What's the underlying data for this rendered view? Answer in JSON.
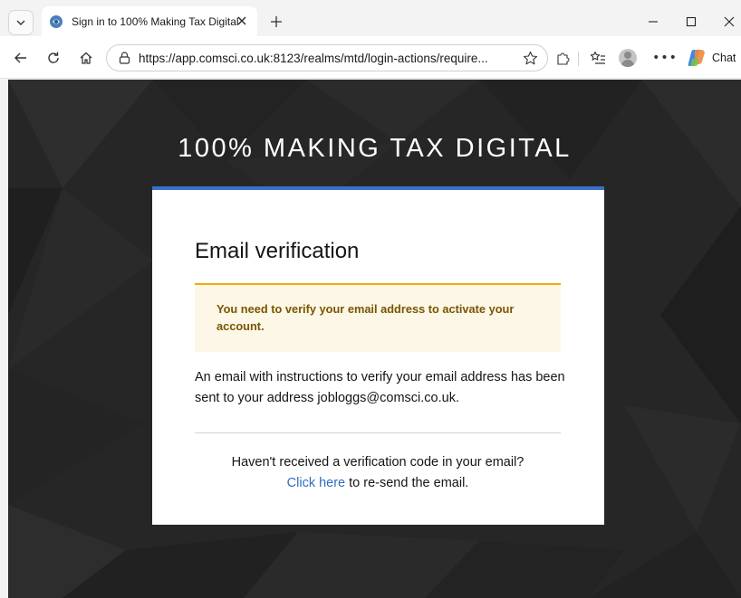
{
  "browser": {
    "tab": {
      "title": "Sign in to 100% Making Tax Digital"
    },
    "address_bar": {
      "url": "https://app.comsci.co.uk:8123/realms/mtd/login-actions/require..."
    },
    "copilot_label": "Chat"
  },
  "page": {
    "site_title": "100% MAKING TAX DIGITAL",
    "card": {
      "heading": "Email verification",
      "alert_text": "You need to verify your email address to activate your account.",
      "info_text": "An email with instructions to verify your email address has been sent to your address jobloggs@comsci.co.uk.",
      "resend_prompt": "Haven't received a verification code in your email?",
      "resend_link": "Click here",
      "resend_suffix": " to re-send the email."
    }
  },
  "colors": {
    "accent_bar": "#3b6fc9",
    "alert_border": "#f0ab00",
    "alert_background": "#fdf7e7",
    "link": "#2f6ec4",
    "page_background": "#262626"
  }
}
